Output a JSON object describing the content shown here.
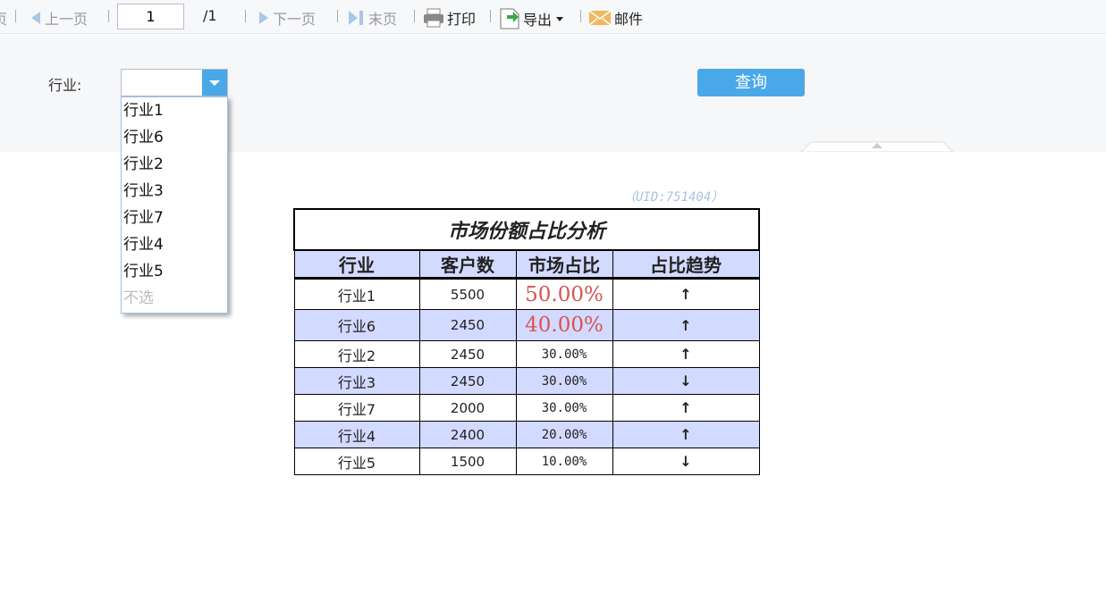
{
  "toolbar": {
    "prev_partial": "页",
    "prev": "上一页",
    "page": "1",
    "total": "/1",
    "next": "下一页",
    "last": "末页",
    "print": "打印",
    "export": "导出",
    "mail": "邮件"
  },
  "params": {
    "label": "行业:",
    "value": "",
    "query": "查询",
    "options": [
      "行业1",
      "行业6",
      "行业2",
      "行业3",
      "行业7",
      "行业4",
      "行业5"
    ],
    "none": "不选"
  },
  "report": {
    "uid": "（UID:751404）",
    "title": "市场份额占比分析",
    "headers": [
      "行业",
      "客户数",
      "市场占比",
      "占比趋势"
    ],
    "rows": [
      [
        "行业1",
        "5500",
        "50.00%",
        "↑"
      ],
      [
        "行业6",
        "2450",
        "40.00%",
        "↑"
      ],
      [
        "行业2",
        "2450",
        "30.00%",
        "↑"
      ],
      [
        "行业3",
        "2450",
        "30.00%",
        "↓"
      ],
      [
        "行业7",
        "2000",
        "30.00%",
        "↑"
      ],
      [
        "行业4",
        "2400",
        "20.00%",
        "↑"
      ],
      [
        "行业5",
        "1500",
        "10.00%",
        "↓"
      ]
    ]
  },
  "colors": {
    "accent": "#49a8e8",
    "header_bg": "#d2daff",
    "highlight": "#d9534f"
  }
}
